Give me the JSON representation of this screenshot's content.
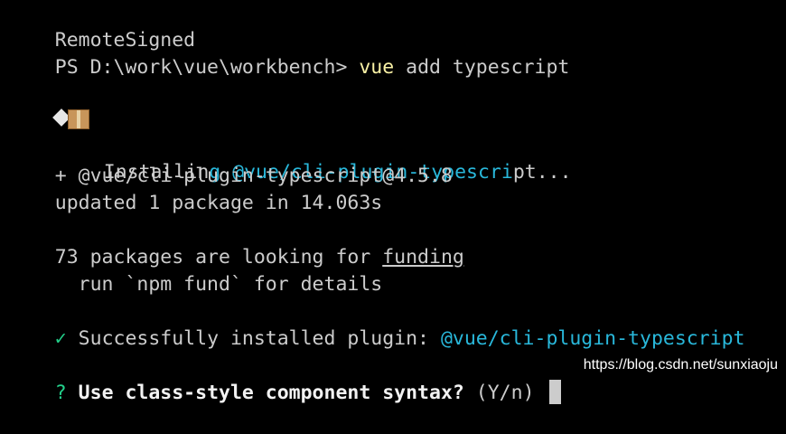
{
  "lines": {
    "l1": "RemoteSigned",
    "prompt": "PS D:\\work\\vue\\workbench>",
    "cmd_name": "vue",
    "cmd_args": "add typescript",
    "installing_prefix": "Installin",
    "installing_pkg": "g @vue/cli-plugin-typescri",
    "installing_suffix": "pt...",
    "added": "+ @vue/cli-plugin-typescript@4.5.8",
    "updated": "updated 1 package in 14.063s",
    "funding_prefix": "73 packages are looking for ",
    "funding_link": "funding",
    "run_fund": "  run `npm fund` for details",
    "check": "✓",
    "success_text": " Successfully installed plugin: ",
    "success_pkg": "@vue/cli-plugin-typescript",
    "question_mark": "?",
    "question": " Use class-style component syntax?",
    "question_options": " (Y/n) "
  },
  "icons": {
    "installing": "question-box-icon"
  },
  "watermark": "https://blog.csdn.net/sunxiaoju",
  "colors": {
    "background": "#000000",
    "text": "#cccccc",
    "yellow": "#f9f1a5",
    "cyan": "#29b8db",
    "green": "#23d18b"
  }
}
